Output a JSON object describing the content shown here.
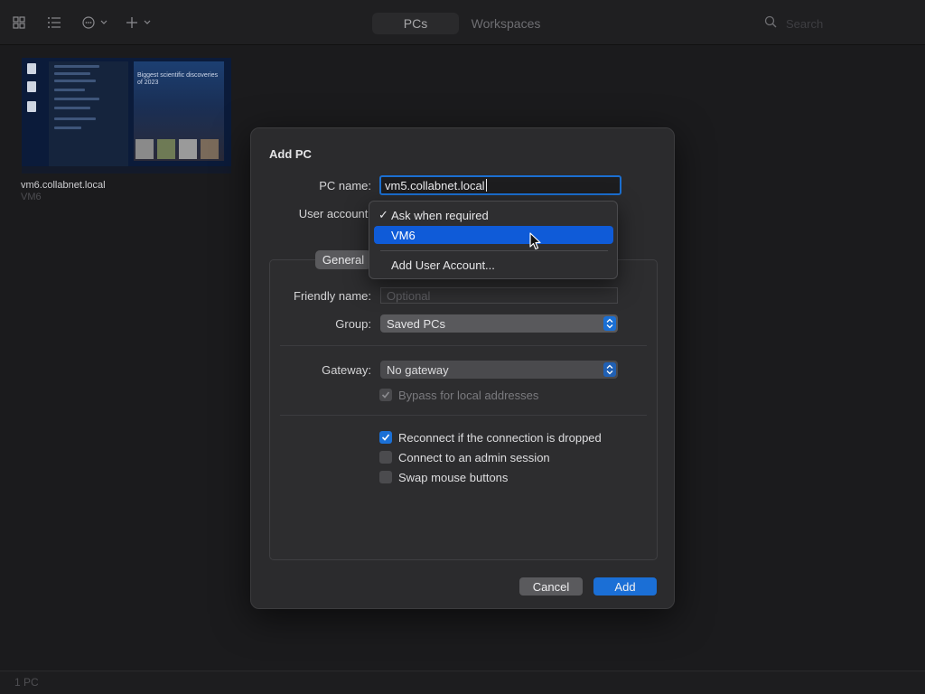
{
  "toolbar": {
    "icons": [
      "grid-view-icon",
      "list-view-icon",
      "more-options-icon",
      "add-icon",
      "search-icon"
    ],
    "tabs": [
      {
        "label": "PCs",
        "selected": true
      },
      {
        "label": "Workspaces",
        "selected": false
      }
    ],
    "search_placeholder": "Search"
  },
  "thumbnail": {
    "headline": "Biggest scientific discoveries of 2023",
    "pc_name": "vm6.collabnet.local",
    "pc_user": "VM6"
  },
  "status": {
    "text": "1 PC"
  },
  "dialog": {
    "title": "Add PC",
    "pc_name_label": "PC name:",
    "pc_name_value": "vm5.collabnet.local",
    "user_account_label": "User account:",
    "tab_label": "General",
    "friendly_name_label": "Friendly name:",
    "friendly_name_placeholder": "Optional",
    "group_label": "Group:",
    "group_value": "Saved PCs",
    "gateway_label": "Gateway:",
    "gateway_value": "No gateway",
    "bypass_label": "Bypass for local addresses",
    "bypass_checked": true,
    "reconnect_label": "Reconnect if the connection is dropped",
    "reconnect_checked": true,
    "admin_label": "Connect to an admin session",
    "admin_checked": false,
    "swap_label": "Swap mouse buttons",
    "swap_checked": false,
    "cancel_label": "Cancel",
    "add_label": "Add"
  },
  "user_menu": {
    "items": [
      {
        "label": "Ask when required",
        "checked": true
      },
      {
        "label": "VM6",
        "highlighted": true
      },
      {
        "label": "Add User Account..."
      }
    ]
  },
  "colors": {
    "accent": "#1b6fd6",
    "highlight": "#0f5bd8",
    "background": "#1b1b1d",
    "dialog": "#2b2b2d"
  }
}
